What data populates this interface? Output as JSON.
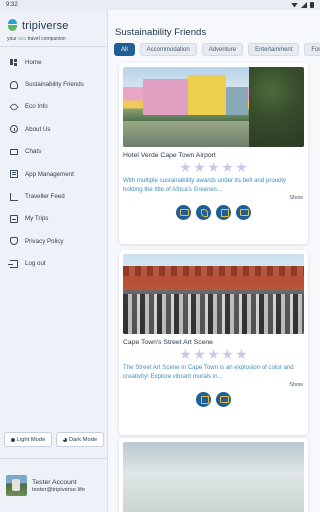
{
  "status_bar": {
    "time": "9:32"
  },
  "brand": {
    "name": "tripiverse",
    "tagline_pre": "your ",
    "tagline_eco": "eco",
    "tagline_post": " travel companion"
  },
  "nav": [
    {
      "label": "Home",
      "icon": "home-icon"
    },
    {
      "label": "Sustainability Friends",
      "icon": "friends-icon"
    },
    {
      "label": "Eco Info",
      "icon": "leaf-icon"
    },
    {
      "label": "About Us",
      "icon": "info-icon"
    },
    {
      "label": "Chats",
      "icon": "chat-icon"
    },
    {
      "label": "App Management",
      "icon": "app-management-icon"
    },
    {
      "label": "Traveller Feed",
      "icon": "feed-icon"
    },
    {
      "label": "My Trips",
      "icon": "trips-icon"
    },
    {
      "label": "Privacy Policy",
      "icon": "shield-icon"
    },
    {
      "label": "Log out",
      "icon": "logout-icon"
    }
  ],
  "mode": {
    "light": "Light Mode",
    "dark": "Dark Mode"
  },
  "account": {
    "name": "Tester Account",
    "email": "tester@tripiverse.life"
  },
  "main": {
    "title": "Sustainability Friends",
    "filters": [
      "All",
      "Accommodation",
      "Adventure",
      "Entertainment",
      "Food"
    ],
    "active_filter": "All",
    "cards": [
      {
        "title": "Hotel Verde Cape Town Airport",
        "rating": 0,
        "description": "With multiple sustainability awards under its belt and proudly holding the title of Africa's Greenes...",
        "show": "Show",
        "actions": [
          "email-icon",
          "phone-icon",
          "map-icon",
          "chat-icon"
        ]
      },
      {
        "title": "Cape Town's Street Art Scene",
        "rating": 0,
        "description": "The Street Art Scene in Cape Town is an explosion of color and creativity! Explore vibrant murals in...",
        "show": "Show",
        "actions": [
          "map-icon",
          "chat-icon"
        ]
      }
    ]
  },
  "colors": {
    "accent": "#1f5f95",
    "eco_green": "#5cb85c",
    "desc_blue": "#3f8fc0",
    "star": "#c3c9e6"
  }
}
